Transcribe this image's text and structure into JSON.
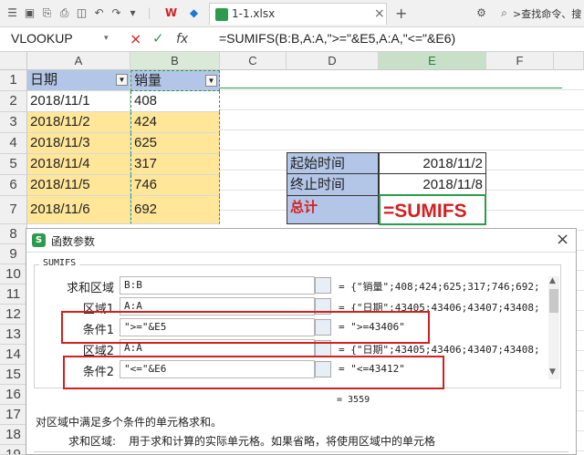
{
  "toolbar": {
    "file_tab": "1-1.xlsx",
    "close": "×",
    "new_tab": "+",
    "search_placeholder": ">查找命令、搜"
  },
  "formula_bar": {
    "name_box": "VLOOKUP",
    "cancel": "×",
    "confirm": "✓",
    "fx": "fx",
    "formula": "=SUMIFS(B:B,A:A,\">=\"&E5,A:A,\"<=\"&E6)"
  },
  "columns": [
    "A",
    "B",
    "C",
    "D",
    "E",
    "F"
  ],
  "rows": [
    "1",
    "2",
    "3",
    "4",
    "5",
    "6",
    "7",
    "8",
    "9",
    "10",
    "11",
    "12",
    "13",
    "14",
    "15",
    "16",
    "17",
    "18",
    "19"
  ],
  "cells": {
    "a1": "日期",
    "b1": "销量",
    "a2": "2018/11/1",
    "b2": "408",
    "a3": "2018/11/2",
    "b3": "424",
    "a4": "2018/11/3",
    "b4": "625",
    "a5": "2018/11/4",
    "b5": "317",
    "a6": "2018/11/5",
    "b6": "746",
    "a7": "2018/11/6",
    "b7": "692",
    "d5": "起始时间",
    "e5": "2018/11/2",
    "d6": "终止时间",
    "e6": "2018/11/8",
    "d7": "总计",
    "e7": "=SUMIFS"
  },
  "dialog": {
    "title": "函数参数",
    "close": "×",
    "func_name": "SUMIFS",
    "params": [
      {
        "label": "求和区域",
        "value": "B:B",
        "result": "= {\"销量\";408;424;625;317;746;692;"
      },
      {
        "label": "区域1",
        "value": "A:A",
        "result": "= {\"日期\";43405;43406;43407;43408;"
      },
      {
        "label": "条件1",
        "value": "\">=\"&E5",
        "result": "= \">=43406\""
      },
      {
        "label": "区域2",
        "value": "A:A",
        "result": "= {\"日期\";43405;43406;43407;43408;"
      },
      {
        "label": "条件2",
        "value": "\"<=\"&E6",
        "result": "= \"<=43412\""
      }
    ],
    "total": "= 3559",
    "description": "对区域中满足多个条件的单元格求和。",
    "param_help_label": "求和区域:",
    "param_help": "用于求和计算的实际单元格。如果省略，将使用区域中的单元格"
  },
  "colors": {
    "header_fill": "#b4c6e7",
    "data_fill": "#ffe699",
    "accent": "#d42020",
    "green": "#2e9a4e"
  }
}
